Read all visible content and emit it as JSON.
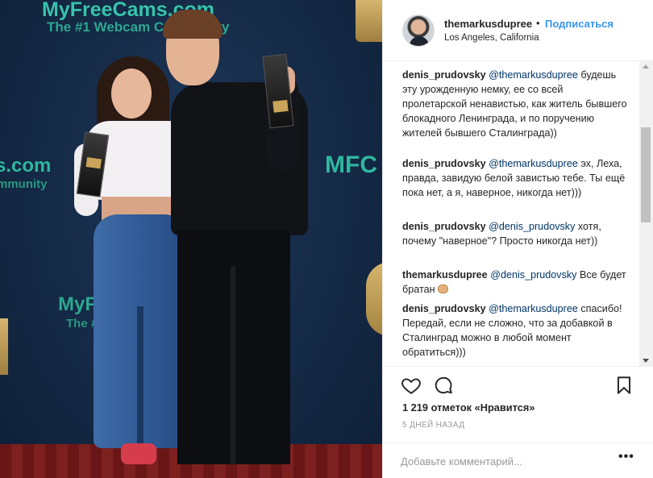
{
  "photo": {
    "backdrop_texts": {
      "top_line1": "MyFreeCams.com",
      "top_line2": "The #1 Webcam Community",
      "mid_left1": "s.com",
      "mid_left2": "mmunity",
      "mid_right": "MFC",
      "low_line1": "MyFreeCams.com",
      "low_line2": "The #1 Webcam Community"
    }
  },
  "post": {
    "author": "themarkusdupree",
    "separator": "•",
    "follow_label": "Подписаться",
    "location": "Los Angeles, California"
  },
  "comments": [
    {
      "author": "denis_prudovsky",
      "mention": "@themarkusdupree",
      "text": " будешь         эту урожденную немку,         ее со всей пролетарской ненавистью, как житель бывшего блокадного Ленинграда, и по поручению жителей бывшего Сталинграда))"
    },
    {
      "author": "denis_prudovsky",
      "mention": "@themarkusdupree",
      "text": " эх, Леха, правда, завидую белой завистью тебе. Ты ещё пока нет, а я, наверное, никогда нет)))"
    },
    {
      "author": "denis_prudovsky",
      "mention": "@denis_prudovsky",
      "text": " хотя, почему \"наверное\"? Просто никогда нет))"
    },
    {
      "author": "themarkusdupree",
      "mention": "@denis_prudovsky",
      "text": " Все будет братан "
    },
    {
      "author": "denis_prudovsky",
      "mention": "@themarkusdupree",
      "text": " спасибо! Передай, если не сложно, что за добавкой в Сталинград можно в любой момент обратиться)))"
    }
  ],
  "likes_text": "1 219 отметок «Нравится»",
  "time_text": "5 ДНЕЙ НАЗАД",
  "add_comment_placeholder": "Добавьте комментарий...",
  "more_label": "•••",
  "icons": {
    "like": "heart-icon",
    "comment": "comment-bubble-icon",
    "save": "bookmark-icon",
    "emoji": "fist-emoji-icon"
  },
  "colors": {
    "link": "#3897f0",
    "mention": "#003569",
    "text": "#262626",
    "muted": "#999999",
    "brand_teal": "#37c4ac"
  }
}
